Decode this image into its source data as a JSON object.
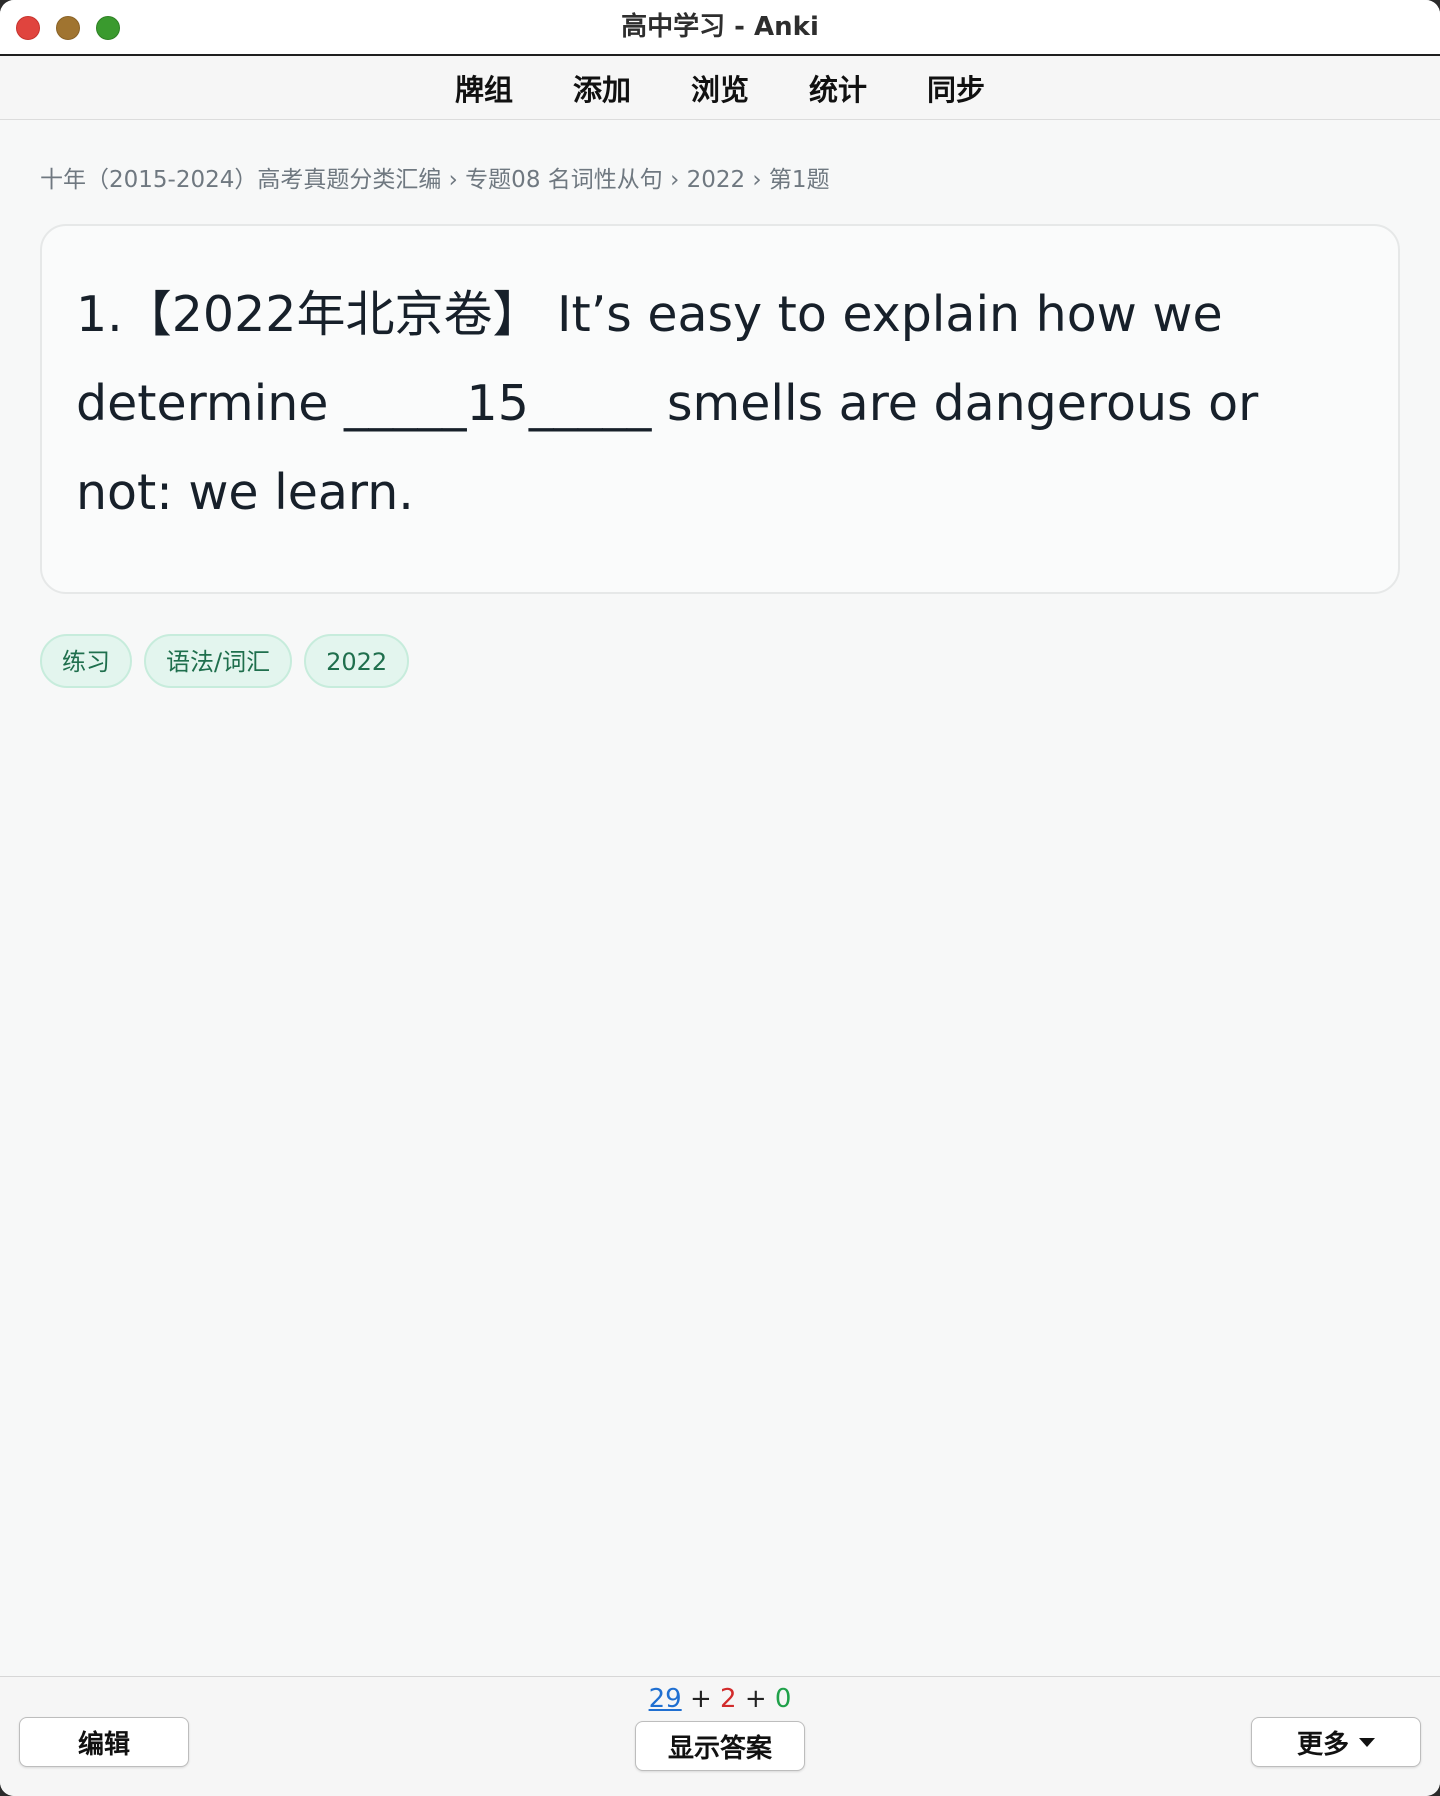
{
  "window": {
    "title": "高中学习 - Anki"
  },
  "menu": [
    {
      "label": "牌组"
    },
    {
      "label": "添加"
    },
    {
      "label": "浏览"
    },
    {
      "label": "统计"
    },
    {
      "label": "同步"
    }
  ],
  "breadcrumb": "十年（2015-2024）高考真题分类汇编 › 专题08 名词性从句 › 2022 › 第1题",
  "card": {
    "question": "1.【2022年北京卷】 It’s easy to explain how we determine _____15_____ smells are dangerous or not: we learn."
  },
  "tags": [
    {
      "label": "练习"
    },
    {
      "label": "语法/词汇"
    },
    {
      "label": "2022"
    }
  ],
  "counts": {
    "new": "29",
    "learning": "2",
    "review": "0",
    "separator": "+"
  },
  "buttons": {
    "edit": "编辑",
    "show_answer": "显示答案",
    "more": "更多"
  },
  "icons": {
    "close": "close-icon",
    "minimize": "minimize-icon",
    "maximize": "maximize-icon",
    "more_caret": "caret-down-icon"
  },
  "colors": {
    "new": "#1f6fd1",
    "learning": "#d22b2b",
    "review": "#20a14a",
    "tag_bg": "#e3f5ee",
    "tag_text": "#1f6f4d"
  }
}
